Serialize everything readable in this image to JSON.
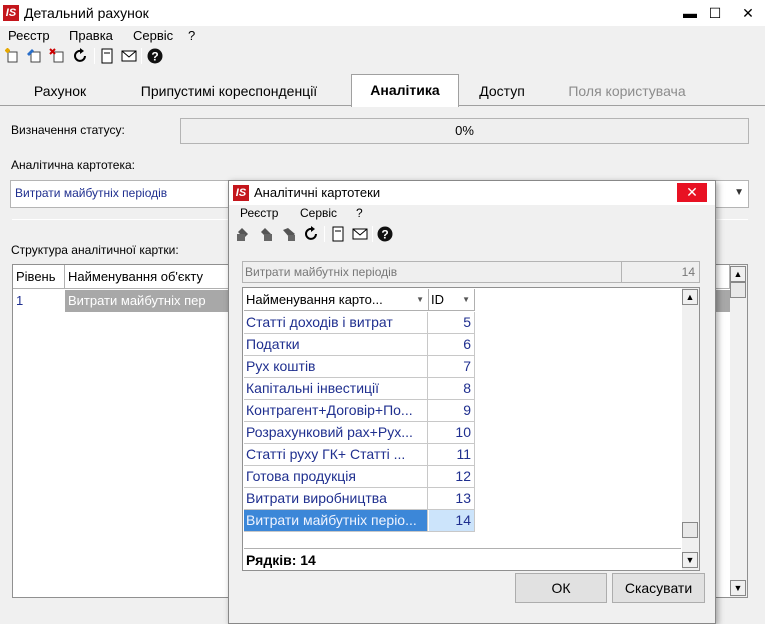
{
  "main_window": {
    "logo": "IS",
    "title": "Детальний рахунок",
    "controls": {
      "minimize": "▬",
      "maximize": "☐",
      "close": "✕"
    },
    "menu": [
      "Реєстр",
      "Правка",
      "Сервіс",
      "?"
    ],
    "toolbar_icons": [
      "add-icon",
      "edit-icon",
      "delete-icon",
      "refresh-icon",
      "document-icon",
      "mail-icon",
      "help-icon"
    ],
    "tabs": [
      {
        "label": "Рахунок",
        "state": "normal"
      },
      {
        "label": "Припустимі кореспонденції",
        "state": "normal"
      },
      {
        "label": "Аналітика",
        "state": "active"
      },
      {
        "label": "Доступ",
        "state": "normal"
      },
      {
        "label": "Поля користувача",
        "state": "disabled"
      }
    ],
    "status_label": "Визначення статусу:",
    "status_value": "0%",
    "card_label": "Аналітична картотека:",
    "card_value": "Витрати майбутніх періодів",
    "structure_label": "Структура аналітичної картки:",
    "structure_grid": {
      "columns": [
        "Рівень",
        "Найменування об'єкту"
      ],
      "rows": [
        {
          "level": "1",
          "name": "Витрати майбутніх пер"
        }
      ]
    }
  },
  "dialog": {
    "logo": "IS",
    "title": "Аналітичні картотеки",
    "close": "✕",
    "menu": [
      "Реєстр",
      "Сервіс",
      "?"
    ],
    "toolbar_icons": [
      "add-icon",
      "edit-icon",
      "delete-icon",
      "refresh-icon",
      "document-icon",
      "mail-icon",
      "help-icon"
    ],
    "selected": {
      "name": "Витрати майбутніх періодів",
      "id": "14"
    },
    "grid": {
      "columns": [
        "Найменування карто...",
        "ID"
      ],
      "rows": [
        {
          "name": "Статті доходів і витрат",
          "id": "5"
        },
        {
          "name": "Податки",
          "id": "6"
        },
        {
          "name": "Рух коштів",
          "id": "7"
        },
        {
          "name": "Капітальні інвестиції",
          "id": "8"
        },
        {
          "name": "Контрагент+Договір+По...",
          "id": "9"
        },
        {
          "name": "Розрахунковий рах+Рух...",
          "id": "10"
        },
        {
          "name": "Статті руху ГК+ Статті ...",
          "id": "11"
        },
        {
          "name": "Готова продукція",
          "id": "12"
        },
        {
          "name": "Витрати виробництва",
          "id": "13"
        },
        {
          "name": "Витрати майбутніх періо...",
          "id": "14"
        }
      ],
      "selected_row_index": 9,
      "footer": "Рядків: 14"
    },
    "buttons": {
      "ok": "ОК",
      "cancel": "Скасувати"
    }
  },
  "colors": {
    "logo_red": "#c4161c",
    "close_red": "#e81123",
    "link_blue": "#1f2f8f",
    "selection_blue": "#3c87d8"
  }
}
